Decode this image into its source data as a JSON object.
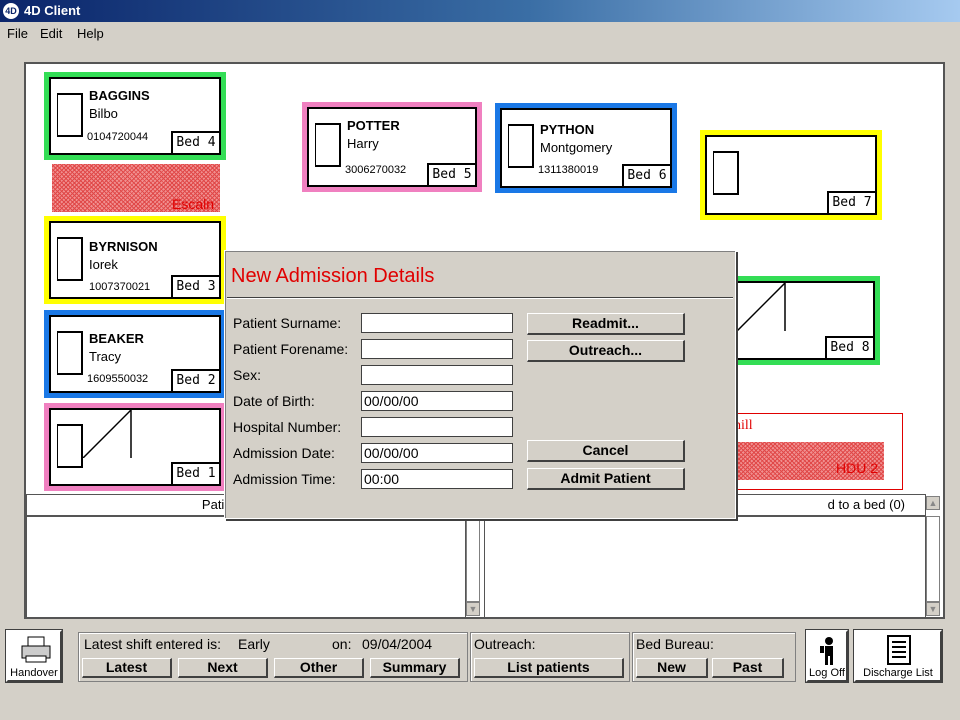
{
  "window": {
    "title": "4D Client",
    "logo": "4D"
  },
  "menu": [
    "File",
    "Edit",
    "Help"
  ],
  "beds": [
    {
      "label": "Bed 4",
      "surname": "BAGGINS",
      "forename": "Bilbo",
      "number": "0104720044",
      "color": "#33dd55"
    },
    {
      "label": "Bed 5",
      "surname": "POTTER",
      "forename": "Harry",
      "number": "3006270032",
      "color": "#f080c0"
    },
    {
      "label": "Bed 6",
      "surname": "PYTHON",
      "forename": "Montgomery",
      "number": "1311380019",
      "color": "#1a78e6"
    },
    {
      "label": "Bed 7",
      "surname": "",
      "forename": "",
      "number": "",
      "color": "#ffff00"
    },
    {
      "label": "Bed 3",
      "surname": "BYRNISON",
      "forename": "Iorek",
      "number": "1007370021",
      "color": "#ffff00"
    },
    {
      "label": "Bed 2",
      "surname": "BEAKER",
      "forename": "Tracy",
      "number": "1609550032",
      "color": "#1a78e6"
    },
    {
      "label": "Bed 1",
      "surname": "",
      "forename": "",
      "number": "",
      "color": "#f080c0"
    },
    {
      "label": "Bed 8",
      "surname": "",
      "forename": "",
      "number": "",
      "color": "#33dd55"
    }
  ],
  "escalation_label": "Escaln",
  "hdu": {
    "partial_label": "hill",
    "bed_label": "HDU 2"
  },
  "lists": {
    "left_header": "Patients with m",
    "right_header": "d to a bed (0)"
  },
  "dialog": {
    "title": "New Admission Details",
    "fields": [
      {
        "label": "Patient Surname:",
        "value": ""
      },
      {
        "label": "Patient Forename:",
        "value": ""
      },
      {
        "label": "Sex:",
        "value": ""
      },
      {
        "label": "Date of Birth:",
        "value": "00/00/00"
      },
      {
        "label": "Hospital Number:",
        "value": ""
      },
      {
        "label": "Admission Date:",
        "value": "00/00/00"
      },
      {
        "label": "Admission Time:",
        "value": "00:00"
      }
    ],
    "buttons": {
      "readmit": "Readmit...",
      "outreach": "Outreach...",
      "cancel": "Cancel",
      "admit": "Admit Patient"
    }
  },
  "toolbar": {
    "handover": "Handover",
    "shift_label": "Latest shift entered is:",
    "shift_value": "Early",
    "on_label": "on:",
    "on_value": "09/04/2004",
    "outreach_label": "Outreach:",
    "bed_bureau_label": "Bed Bureau:",
    "latest": "Latest",
    "next": "Next",
    "other": "Other",
    "summary": "Summary",
    "list_patients": "List patients",
    "new": "New",
    "past": "Past",
    "log_off": "Log Off",
    "discharge_list": "Discharge List"
  }
}
